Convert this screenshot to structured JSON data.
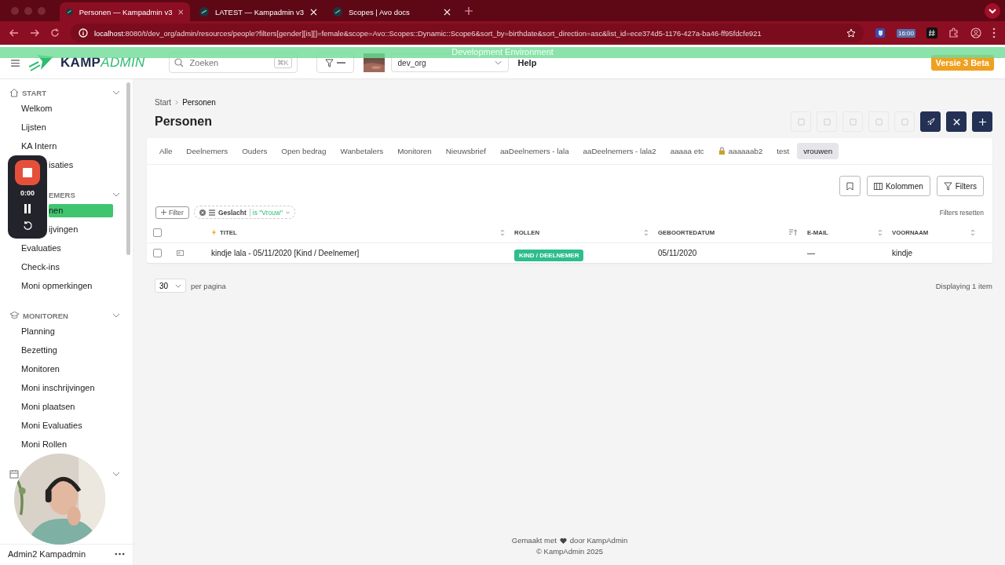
{
  "browser": {
    "tabs": [
      {
        "title": "Personen — Kampadmin v3",
        "selected": true
      },
      {
        "title": "LATEST — Kampadmin v3",
        "selected": false
      },
      {
        "title": "Scopes | Avo docs",
        "selected": false
      }
    ],
    "url_host": "localhost",
    "url_path": ":8080/t/dev_org/admin/resources/people?filters[gender][is][]=female&scope=Avo::Scopes::Dynamic::Scope6&sort_by=birthdate&sort_direction=asc&list_id=ece374d5-1176-427a-ba46-ff95fdcfe921",
    "extension_time": "16:00"
  },
  "dev_banner": "Development Environment",
  "header": {
    "logo_bold": "KAMP",
    "logo_light": "ADMIN",
    "search": {
      "placeholder": "Zoeken",
      "shortcut": "⌘K"
    },
    "org": "dev_org",
    "help": "Help",
    "version": "Versie 3 Beta"
  },
  "sidebar": {
    "sections": [
      {
        "title": "START",
        "covered": false,
        "items": [
          {
            "label": "Welkom",
            "selected": false,
            "covered": false
          },
          {
            "label": "Lijsten",
            "selected": false,
            "covered": false
          },
          {
            "label": "KA Intern",
            "selected": false,
            "covered": false
          },
          {
            "label": "isaties",
            "selected": false,
            "covered": true
          }
        ]
      },
      {
        "title": "EMERS",
        "covered": true,
        "items": [
          {
            "label": "nen",
            "selected": true,
            "covered": true
          },
          {
            "label": "ijvingen",
            "selected": false,
            "covered": true
          },
          {
            "label": "Evaluaties",
            "selected": false,
            "covered": false
          },
          {
            "label": "Check-ins",
            "selected": false,
            "covered": false
          },
          {
            "label": "Moni opmerkingen",
            "selected": false,
            "covered": false
          }
        ]
      },
      {
        "title": "MONITOREN",
        "covered": false,
        "items": [
          {
            "label": "Planning",
            "selected": false,
            "covered": false
          },
          {
            "label": "Bezetting",
            "selected": false,
            "covered": false
          },
          {
            "label": "Monitoren",
            "selected": false,
            "covered": false
          },
          {
            "label": "Moni inschrijvingen",
            "selected": false,
            "covered": false
          },
          {
            "label": "Moni plaatsen",
            "selected": false,
            "covered": false
          },
          {
            "label": "Moni Evaluaties",
            "selected": false,
            "covered": false
          },
          {
            "label": "Moni Rollen",
            "selected": false,
            "covered": false
          }
        ]
      }
    ],
    "user": "Admin2 Kampadmin"
  },
  "recorder": {
    "time": "0:00"
  },
  "main": {
    "breadcrumb": [
      "Start",
      "Personen"
    ],
    "title": "Personen",
    "actions": [
      {
        "disabled": true
      },
      {
        "disabled": true
      },
      {
        "disabled": true
      },
      {
        "disabled": true
      },
      {
        "disabled": true
      },
      {
        "disabled": false
      },
      {
        "disabled": false
      },
      {
        "disabled": false
      }
    ],
    "tabs": [
      {
        "label": "Alle",
        "selected": false,
        "locked": false
      },
      {
        "label": "Deelnemers",
        "selected": false,
        "locked": false
      },
      {
        "label": "Ouders",
        "selected": false,
        "locked": false
      },
      {
        "label": "Open bedrag",
        "selected": false,
        "locked": false
      },
      {
        "label": "Wanbetalers",
        "selected": false,
        "locked": false
      },
      {
        "label": "Monitoren",
        "selected": false,
        "locked": false
      },
      {
        "label": "Nieuwsbrief",
        "selected": false,
        "locked": false
      },
      {
        "label": "aaDeelnemers - lala",
        "selected": false,
        "locked": false
      },
      {
        "label": "aaDeelnemers - lala2",
        "selected": false,
        "locked": false
      },
      {
        "label": "aaaaa etc",
        "selected": false,
        "locked": false
      },
      {
        "label": "aaaaaab2",
        "selected": false,
        "locked": true
      },
      {
        "label": "test",
        "selected": false,
        "locked": false
      },
      {
        "label": "vrouwen",
        "selected": true,
        "locked": false
      }
    ],
    "columns_button": "Kolommen",
    "filters_button": "Filters",
    "filter_button": "Filter",
    "chip": {
      "field": "Geslacht",
      "value": "is \"Vrouw\""
    },
    "reset": "Filters resetten",
    "header_checked": false,
    "columns": [
      {
        "label": "TITEL",
        "sorted": false
      },
      {
        "label": "ROLLEN",
        "sorted": false
      },
      {
        "label": "GEBOORTEDATUM",
        "sorted": true
      },
      {
        "label": "E-MAIL",
        "sorted": false
      },
      {
        "label": "VOORNAAM",
        "sorted": false
      }
    ],
    "rows": [
      {
        "checked": false,
        "title": "kindje lala - 05/11/2020 [Kind / Deelnemer]",
        "role": "KIND / DEELNEMER",
        "birthdate": "05/11/2020",
        "email": "—",
        "first_name": "kindje"
      }
    ],
    "per_page": "30",
    "per_page_label": "per pagina",
    "count": "Displaying 1 item"
  },
  "footer": {
    "before": "Gemaakt met",
    "after": "door KampAdmin",
    "copyright": "© KampAdmin 2025"
  }
}
